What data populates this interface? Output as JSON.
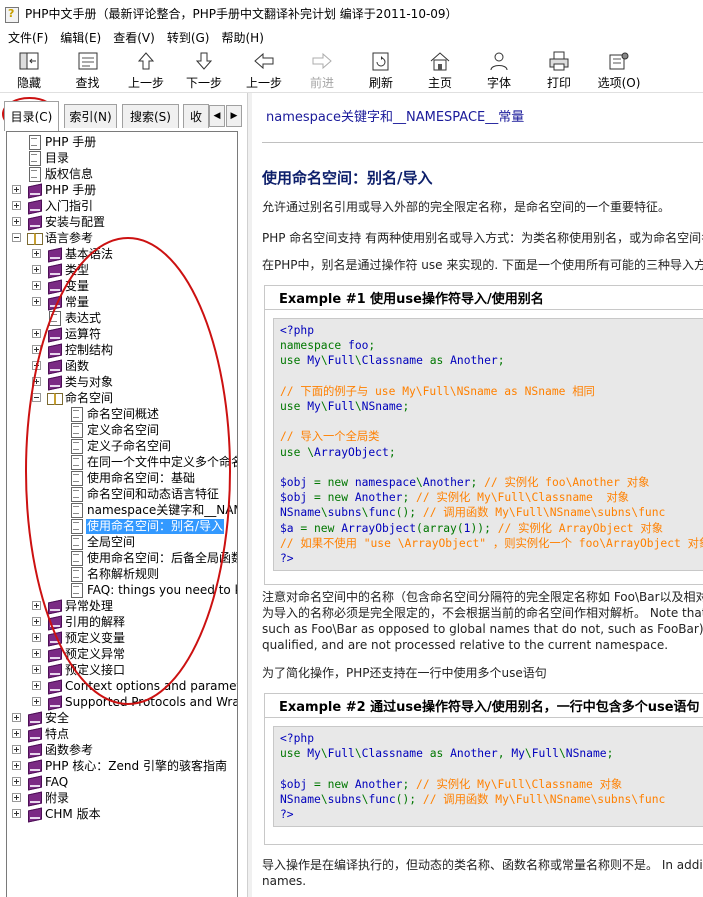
{
  "window": {
    "title": "PHP中文手册（最新评论整合，PHP手册中文翻译补完计划 编译于2011-10-09）"
  },
  "menu": [
    {
      "label": "文件(F)"
    },
    {
      "label": "编辑(E)"
    },
    {
      "label": "查看(V)"
    },
    {
      "label": "转到(G)"
    },
    {
      "label": "帮助(H)"
    }
  ],
  "toolbar": [
    {
      "label": "隐藏",
      "icon": "hide-icon"
    },
    {
      "label": "查找",
      "icon": "find-icon"
    },
    {
      "label": "上一步",
      "icon": "up-arrow-icon"
    },
    {
      "label": "下一步",
      "icon": "down-arrow-icon"
    },
    {
      "label": "上一步",
      "icon": "back-arrow-icon"
    },
    {
      "label": "前进",
      "icon": "forward-arrow-icon",
      "disabled": true
    },
    {
      "label": "刷新",
      "icon": "refresh-icon"
    },
    {
      "label": "主页",
      "icon": "home-icon"
    },
    {
      "label": "字体",
      "icon": "font-icon"
    },
    {
      "label": "打印",
      "icon": "print-icon"
    },
    {
      "label": "选项(O)",
      "icon": "options-icon"
    }
  ],
  "tabs": [
    {
      "label": "目录(C)",
      "active": true
    },
    {
      "label": "索引(N)"
    },
    {
      "label": "搜索(S)"
    },
    {
      "label": "收"
    }
  ],
  "tree": [
    {
      "label": "PHP 手册",
      "icon": "page",
      "level": 1
    },
    {
      "label": "目录",
      "icon": "page",
      "level": 1
    },
    {
      "label": "版权信息",
      "icon": "page",
      "level": 1
    },
    {
      "label": "PHP 手册",
      "icon": "book",
      "level": 1,
      "exp": "plus"
    },
    {
      "label": "入门指引",
      "icon": "book",
      "level": 1,
      "exp": "plus"
    },
    {
      "label": "安装与配置",
      "icon": "book",
      "level": 1,
      "exp": "plus"
    },
    {
      "label": "语言参考",
      "icon": "openbook",
      "level": 1,
      "exp": "minus"
    },
    {
      "label": "基本语法",
      "icon": "book",
      "level": 2,
      "exp": "plus"
    },
    {
      "label": "类型",
      "icon": "book",
      "level": 2,
      "exp": "plus"
    },
    {
      "label": "变量",
      "icon": "book",
      "level": 2,
      "exp": "plus"
    },
    {
      "label": "常量",
      "icon": "book",
      "level": 2,
      "exp": "plus"
    },
    {
      "label": "表达式",
      "icon": "page",
      "level": 2
    },
    {
      "label": "运算符",
      "icon": "book",
      "level": 2,
      "exp": "plus"
    },
    {
      "label": "控制结构",
      "icon": "book",
      "level": 2,
      "exp": "plus"
    },
    {
      "label": "函数",
      "icon": "book",
      "level": 2,
      "exp": "plus"
    },
    {
      "label": "类与对象",
      "icon": "book",
      "level": 2,
      "exp": "plus"
    },
    {
      "label": "命名空间",
      "icon": "openbook",
      "level": 2,
      "exp": "minus"
    },
    {
      "label": "命名空间概述",
      "icon": "page",
      "level": 3
    },
    {
      "label": "定义命名空间",
      "icon": "page",
      "level": 3
    },
    {
      "label": "定义子命名空间",
      "icon": "page",
      "level": 3
    },
    {
      "label": "在同一个文件中定义多个命名空间",
      "icon": "page",
      "level": 3
    },
    {
      "label": "使用命名空间：基础",
      "icon": "page",
      "level": 3
    },
    {
      "label": "命名空间和动态语言特征",
      "icon": "page",
      "level": 3
    },
    {
      "label": "namespace关键字和__NAMESPACE__常量",
      "icon": "page",
      "level": 3
    },
    {
      "label": "使用命名空间：别名/导入",
      "icon": "page",
      "level": 3,
      "selected": true
    },
    {
      "label": "全局空间",
      "icon": "page",
      "level": 3
    },
    {
      "label": "使用命名空间：后备全局函数/常量",
      "icon": "page",
      "level": 3
    },
    {
      "label": "名称解析规则",
      "icon": "page",
      "level": 3
    },
    {
      "label": "FAQ: things you need to know about namespaces",
      "icon": "page",
      "level": 3
    },
    {
      "label": "异常处理",
      "icon": "book",
      "level": 2,
      "exp": "plus"
    },
    {
      "label": "引用的解释",
      "icon": "book",
      "level": 2,
      "exp": "plus"
    },
    {
      "label": "预定义变量",
      "icon": "book",
      "level": 2,
      "exp": "plus"
    },
    {
      "label": "预定义异常",
      "icon": "book",
      "level": 2,
      "exp": "plus"
    },
    {
      "label": "预定义接口",
      "icon": "book",
      "level": 2,
      "exp": "plus"
    },
    {
      "label": "Context options and parameters",
      "icon": "book",
      "level": 2,
      "exp": "plus"
    },
    {
      "label": "Supported Protocols and Wrappers",
      "icon": "book",
      "level": 2,
      "exp": "plus"
    },
    {
      "label": "安全",
      "icon": "book",
      "level": 1,
      "exp": "plus"
    },
    {
      "label": "特点",
      "icon": "book",
      "level": 1,
      "exp": "plus"
    },
    {
      "label": "函数参考",
      "icon": "book",
      "level": 1,
      "exp": "plus"
    },
    {
      "label": "PHP 核心：Zend 引擎的骇客指南",
      "icon": "book",
      "level": 1,
      "exp": "plus"
    },
    {
      "label": "FAQ",
      "icon": "book",
      "level": 1,
      "exp": "plus"
    },
    {
      "label": "附录",
      "icon": "book",
      "level": 1,
      "exp": "plus"
    },
    {
      "label": "CHM 版本",
      "icon": "book",
      "level": 1,
      "exp": "plus"
    }
  ],
  "content": {
    "nav_link": "namespace关键字和__NAMESPACE__常量",
    "heading": "使用命名空间：别名/导入",
    "p1": "允许通过别名引用或导入外部的完全限定名称，是命名空间的一个重要特征。",
    "p2": "PHP 命名空间支持 有两种使用别名或导入方式：为类名称使用别名，或为命名空间名称使用别名。",
    "p3": "在PHP中，别名是通过操作符 use 来实现的. 下面是一个使用所有可能的三种导入方式的例子：",
    "ex1_title": "Example #1 使用use操作符导入/使用别名",
    "ex1_lines": [
      [
        [
          "d",
          "<?php"
        ]
      ],
      [
        [
          "k",
          "namespace "
        ],
        [
          "d",
          "foo"
        ],
        [
          "k",
          ";"
        ]
      ],
      [
        [
          "k",
          "use "
        ],
        [
          "d",
          "My"
        ],
        [
          "k",
          "\\"
        ],
        [
          "d",
          "Full"
        ],
        [
          "k",
          "\\"
        ],
        [
          "d",
          "Classname "
        ],
        [
          "k",
          "as "
        ],
        [
          "d",
          "Another"
        ],
        [
          "k",
          ";"
        ]
      ],
      [],
      [
        [
          "c",
          "// 下面的例子与 use My\\Full\\NSname as NSname 相同"
        ]
      ],
      [
        [
          "k",
          "use "
        ],
        [
          "d",
          "My"
        ],
        [
          "k",
          "\\"
        ],
        [
          "d",
          "Full"
        ],
        [
          "k",
          "\\"
        ],
        [
          "d",
          "NSname"
        ],
        [
          "k",
          ";"
        ]
      ],
      [],
      [
        [
          "c",
          "// 导入一个全局类"
        ]
      ],
      [
        [
          "k",
          "use \\"
        ],
        [
          "d",
          "ArrayObject"
        ],
        [
          "k",
          ";"
        ]
      ],
      [],
      [
        [
          "d",
          "$obj "
        ],
        [
          "k",
          "= new "
        ],
        [
          "d",
          "namespace"
        ],
        [
          "k",
          "\\"
        ],
        [
          "d",
          "Another"
        ],
        [
          "k",
          "; "
        ],
        [
          "c",
          "// 实例化 foo\\Another 对象"
        ]
      ],
      [
        [
          "d",
          "$obj "
        ],
        [
          "k",
          "= new "
        ],
        [
          "d",
          "Another"
        ],
        [
          "k",
          "; "
        ],
        [
          "c",
          "// 实例化 My\\Full\\Classname  对象"
        ]
      ],
      [
        [
          "d",
          "NSname"
        ],
        [
          "k",
          "\\"
        ],
        [
          "d",
          "subns"
        ],
        [
          "k",
          "\\"
        ],
        [
          "d",
          "func"
        ],
        [
          "k",
          "(); "
        ],
        [
          "c",
          "// 调用函数 My\\Full\\NSname\\subns\\func"
        ]
      ],
      [
        [
          "d",
          "$a "
        ],
        [
          "k",
          "= new "
        ],
        [
          "d",
          "ArrayObject"
        ],
        [
          "k",
          "(array("
        ],
        [
          "d",
          "1"
        ],
        [
          "k",
          ")); "
        ],
        [
          "c",
          "// 实例化 ArrayObject 对象"
        ]
      ],
      [
        [
          "c",
          "// 如果不使用 \"use \\ArrayObject\" ，则实例化一个 foo\\ArrayObject 对象"
        ]
      ],
      [
        [
          "d",
          "?>"
        ]
      ]
    ],
    "note1": "注意对命名空间中的名称（包含命名空间分隔符的完全限定名称如 Foo\\Bar以及相对的不包含命名空间分隔符的全局名称如 FooBar）来说，前导的反斜杠是不必要的也不推荐的，因",
    "note2": "为导入的名称必须是完全限定的，不会根据当前的命名空间作相对解析。  Note that for namespaced names (fully qualified namespace names containing namespace separator,",
    "note3": "such as Foo\\Bar as opposed to global names that do not, such as FooBar), the leading backslash is unnecessary and not recommended, as import names must be fully",
    "note4": "qualified, and are not processed relative to the current namespace.",
    "p4": "为了简化操作，PHP还支持在一行中使用多个use语句",
    "ex2_title": "Example #2 通过use操作符导入/使用别名，一行中包含多个use语句",
    "ex2_lines": [
      [
        [
          "d",
          "<?php"
        ]
      ],
      [
        [
          "k",
          "use "
        ],
        [
          "d",
          "My"
        ],
        [
          "k",
          "\\"
        ],
        [
          "d",
          "Full"
        ],
        [
          "k",
          "\\"
        ],
        [
          "d",
          "Classname "
        ],
        [
          "k",
          "as "
        ],
        [
          "d",
          "Another"
        ],
        [
          "k",
          ", "
        ],
        [
          "d",
          "My"
        ],
        [
          "k",
          "\\"
        ],
        [
          "d",
          "Full"
        ],
        [
          "k",
          "\\"
        ],
        [
          "d",
          "NSname"
        ],
        [
          "k",
          ";"
        ]
      ],
      [],
      [
        [
          "d",
          "$obj "
        ],
        [
          "k",
          "= new "
        ],
        [
          "d",
          "Another"
        ],
        [
          "k",
          "; "
        ],
        [
          "c",
          "// 实例化 My\\Full\\Classname 对象"
        ]
      ],
      [
        [
          "d",
          "NSname"
        ],
        [
          "k",
          "\\"
        ],
        [
          "d",
          "subns"
        ],
        [
          "k",
          "\\"
        ],
        [
          "d",
          "func"
        ],
        [
          "k",
          "(); "
        ],
        [
          "c",
          "// 调用函数 My\\Full\\NSname\\subns\\func"
        ]
      ],
      [
        [
          "d",
          "?>"
        ]
      ]
    ],
    "p5": "导入操作是在编译执行的，但动态的类名称、函数名称或常量名称则不是。  In addition, importing only affects unqualified and qualified names. Fully qualified names are absolute, and unaffected by imports, dynamic class",
    "p6": "names."
  },
  "colors": {
    "annotation": "#cc1111",
    "selection": "#3399ff",
    "heading": "#0d1f6b",
    "code_keyword": "#007700",
    "code_default": "#0000bb",
    "code_comment": "#ff8000"
  }
}
